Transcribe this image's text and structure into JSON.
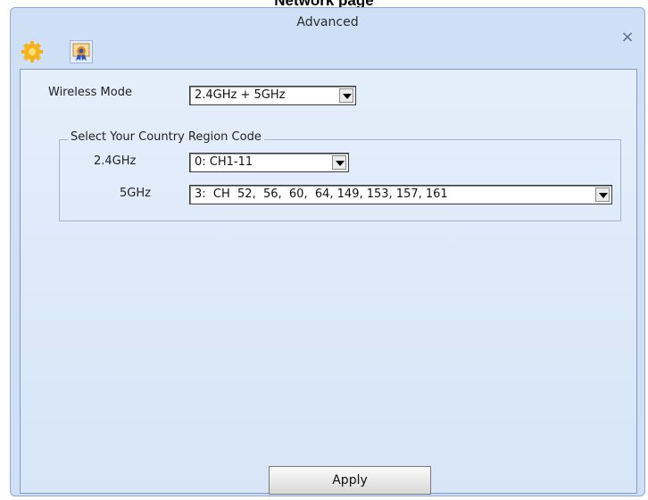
{
  "caption": "Network page",
  "window": {
    "title": "Advanced",
    "close_symbol": "×",
    "tabs": [
      {
        "icon": "gear-icon"
      },
      {
        "icon": "certificate-icon"
      }
    ]
  },
  "form": {
    "wireless_mode": {
      "label": "Wireless Mode",
      "value": "2.4GHz + 5GHz"
    },
    "region_group": {
      "legend": "Select Your Country Region Code",
      "band_24": {
        "label": "2.4GHz",
        "value": "0: CH1-11"
      },
      "band_5": {
        "label": "5GHz",
        "value": "3:  CH  52,  56,  60,  64, 149, 153, 157, 161"
      }
    }
  },
  "apply_label": "Apply",
  "colors": {
    "window_bg": "#cfdff6",
    "panel_bg": "#dde9f8",
    "border": "#7f9bc7"
  }
}
